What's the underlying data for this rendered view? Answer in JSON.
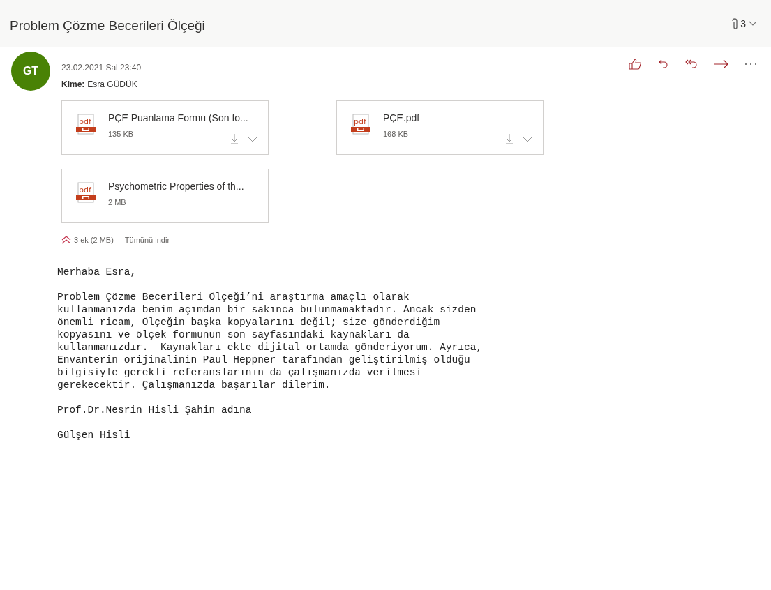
{
  "subject": "Problem Çözme Becerileri Ölçeği",
  "attachment_count": "3",
  "sender": {
    "initials": "GT",
    "date": "23.02.2021 Sal 23:40",
    "to_label": "Kime:",
    "to": "Esra GÜDÜK"
  },
  "attachments": [
    {
      "icon_label": "pdf",
      "name": "PÇE Puanlama Formu (Son fo...",
      "size": "135 KB",
      "actions": true
    },
    {
      "icon_label": "pdf",
      "name": "PÇE.pdf",
      "size": "168 KB",
      "actions": true
    },
    {
      "icon_label": "pdf",
      "name": "Psychometric Properties of th...",
      "size": "2 MB",
      "actions": false
    }
  ],
  "attachments_summary": "3 ek (2 MB)",
  "download_all": "Tümünü indir",
  "body": [
    "Merhaba Esra,",
    "Problem Çözme Becerileri Ölçeği’ni araştırma amaçlı olarak\nkullanmanızda benim açımdan bir sakınca bulunmamaktadır. Ancak sizden\nönemli ricam, Ölçeğin başka kopyalarını değil; size gönderdiğim\nkopyasını ve ölçek formunun son sayfasındaki kaynakları da\nkullanmanızdır.  Kaynakları ekte dijital ortamda gönderiyorum. Ayrıca,\nEnvanterin orijinalinin Paul Heppner tarafından geliştirilmiş olduğu\nbilgisiyle gerekli referanslarının da çalışmanızda verilmesi\ngerekecektir. Çalışmanızda başarılar dilerim.",
    "Prof.Dr.Nesrin Hisli Şahin adına",
    "Gülşen Hisli"
  ]
}
